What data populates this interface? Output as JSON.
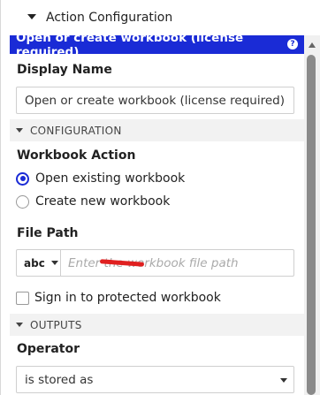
{
  "header": {
    "title": "Action Configuration"
  },
  "titlebar": {
    "text": "Open or create workbook (license required)",
    "help_glyph": "?"
  },
  "display_name": {
    "label": "Display Name",
    "value": "Open or create workbook (license required)"
  },
  "configuration": {
    "group_label": "CONFIGURATION",
    "workbook_action": {
      "label": "Workbook Action",
      "options": [
        "Open existing workbook",
        "Create new workbook"
      ],
      "selected": "Open existing workbook"
    },
    "file_path": {
      "label": "File Path",
      "type_value": "abc",
      "placeholder": "Enter the workbook file path"
    },
    "protected": {
      "label": "Sign in to protected workbook",
      "checked": false
    }
  },
  "outputs": {
    "group_label": "OUTPUTS",
    "operator": {
      "label": "Operator",
      "value": "is stored as"
    }
  },
  "colors": {
    "accent": "#1a2bd6",
    "redaction": "#e02020"
  },
  "icons": {
    "header_caret": "triangle-down-icon",
    "help": "help-icon",
    "group_caret": "chevron-down-icon",
    "select_caret": "dropdown-arrow-icon",
    "scroll_up": "scroll-up-arrow-icon"
  }
}
